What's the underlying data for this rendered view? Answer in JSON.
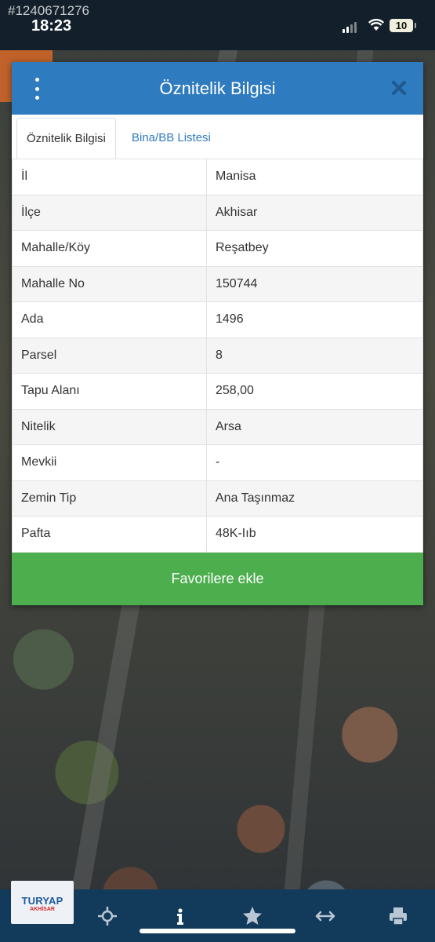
{
  "status_bar": {
    "watermark_id": "#1240671276",
    "time": "18:23",
    "battery": "10"
  },
  "dialog": {
    "title": "Öznitelik Bilgisi",
    "tabs": [
      {
        "label": "Öznitelik Bilgisi",
        "active": true
      },
      {
        "label": "Bina/BB Listesi",
        "active": false
      }
    ],
    "rows": [
      {
        "label": "İl",
        "value": "Manisa"
      },
      {
        "label": "İlçe",
        "value": "Akhisar"
      },
      {
        "label": "Mahalle/Köy",
        "value": "Reşatbey"
      },
      {
        "label": "Mahalle No",
        "value": "150744"
      },
      {
        "label": "Ada",
        "value": "1496"
      },
      {
        "label": "Parsel",
        "value": "8"
      },
      {
        "label": "Tapu Alanı",
        "value": "258,00"
      },
      {
        "label": "Nitelik",
        "value": "Arsa"
      },
      {
        "label": "Mevkii",
        "value": "-"
      },
      {
        "label": "Zemin Tip",
        "value": "Ana Taşınmaz"
      },
      {
        "label": "Pafta",
        "value": "48K-Iıb"
      }
    ],
    "favorite_button": "Favorilere ekle"
  },
  "toolbar": {
    "logo_text": "TURYAP",
    "logo_sub": "AKHİSAR",
    "icons": [
      "locate-icon",
      "info-icon",
      "star-icon",
      "measure-icon",
      "print-icon"
    ]
  },
  "colors": {
    "header_blue": "#2f7bbf",
    "button_green": "#4cae4c",
    "toolbar_navy": "#123a5a"
  }
}
